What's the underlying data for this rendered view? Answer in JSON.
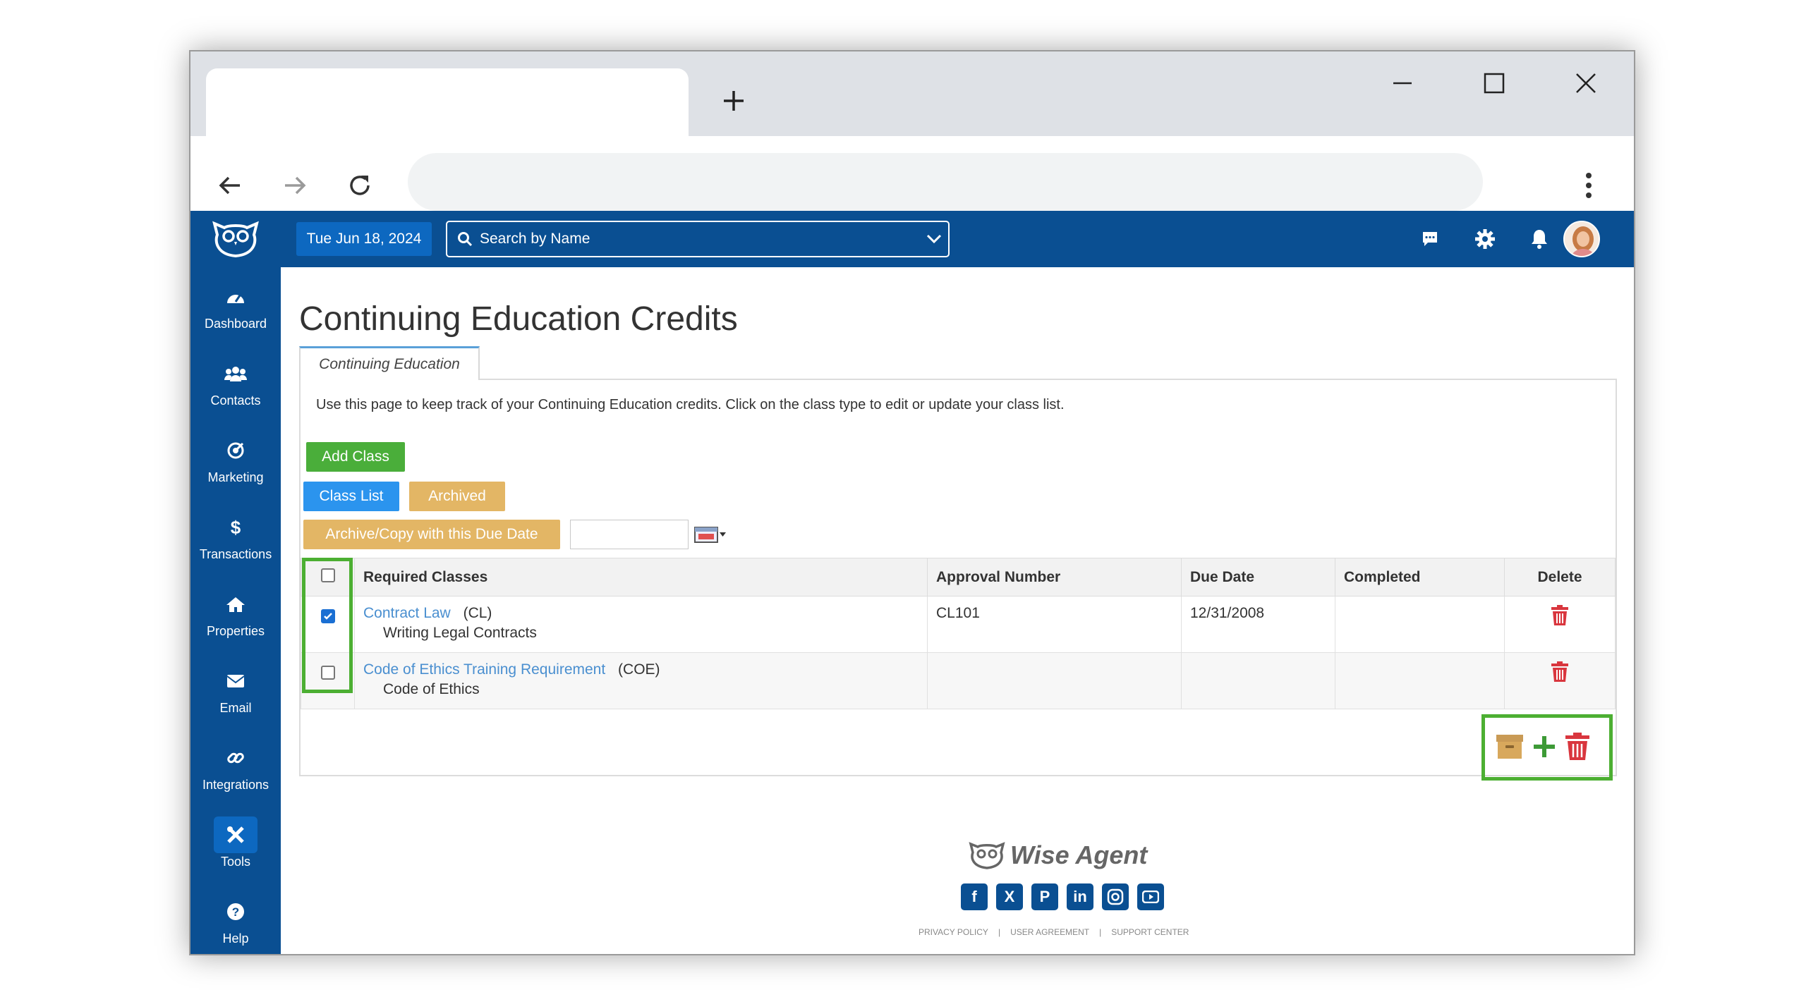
{
  "topbar": {
    "date": "Tue Jun 18, 2024",
    "search_placeholder": "Search by Name"
  },
  "sidebar": {
    "items": [
      {
        "label": "Dashboard",
        "icon": "gauge-icon"
      },
      {
        "label": "Contacts",
        "icon": "people-icon"
      },
      {
        "label": "Marketing",
        "icon": "target-icon"
      },
      {
        "label": "Transactions",
        "icon": "dollar-icon"
      },
      {
        "label": "Properties",
        "icon": "home-icon"
      },
      {
        "label": "Email",
        "icon": "envelope-icon"
      },
      {
        "label": "Integrations",
        "icon": "link-icon"
      },
      {
        "label": "Tools",
        "icon": "tools-icon"
      },
      {
        "label": "Help",
        "icon": "help-icon"
      }
    ],
    "active": "Tools"
  },
  "page": {
    "title": "Continuing Education Credits",
    "tab": "Continuing Education",
    "description": "Use this page to keep track of your Continuing Education credits. Click on the class type to edit or update your class list.",
    "add_class": "Add Class",
    "class_list": "Class List",
    "archived": "Archived",
    "archive_copy": "Archive/Copy with this Due Date",
    "due_date_value": ""
  },
  "table": {
    "headers": [
      "Required Classes",
      "Approval Number",
      "Due Date",
      "Completed",
      "Delete"
    ],
    "rows": [
      {
        "checked": true,
        "name": "Contract Law",
        "code": "(CL)",
        "subtitle": "Writing Legal Contracts",
        "approval": "CL101",
        "due": "12/31/2008",
        "completed": ""
      },
      {
        "checked": false,
        "name": "Code of Ethics Training Requirement",
        "code": "(COE)",
        "subtitle": "Code of Ethics",
        "approval": "",
        "due": "",
        "completed": ""
      }
    ]
  },
  "footer": {
    "brand": "Wise Agent",
    "links": [
      "PRIVACY POLICY",
      "|",
      "USER AGREEMENT",
      "|",
      "SUPPORT CENTER"
    ]
  },
  "colors": {
    "brand": "#0a4f92",
    "green": "#4aae3a",
    "blue": "#2b94ee",
    "tan": "#e3b665",
    "delete_red": "#d9363e",
    "highlight": "#4caf32"
  }
}
